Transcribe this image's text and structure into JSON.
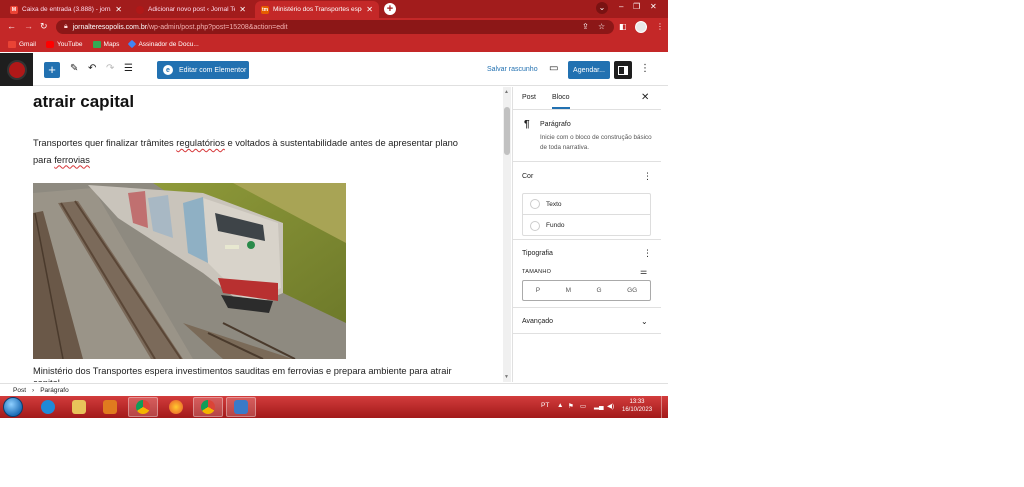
{
  "browser": {
    "tabs": [
      {
        "title": "Caixa de entrada (3.888) - jornalte",
        "favicon_color": "#ea4335",
        "favicon_name": "gmail-icon"
      },
      {
        "title": "Adicionar novo post ‹ Jornal Tere",
        "favicon_color": "#b01818",
        "favicon_name": "jornal-logo-icon"
      },
      {
        "title": "Ministério dos Transportes espe",
        "favicon_color": "#e65c00",
        "favicon_name": "jornal-logo-icon",
        "favicon_text": "tm"
      }
    ],
    "url_host": "jornalteresopolis.com.br",
    "url_path": "/wp-admin/post.php?post=15208&action=edit",
    "bookmarks": [
      {
        "label": "Gmail",
        "color": "#ea4335"
      },
      {
        "label": "YouTube",
        "color": "#ff0000"
      },
      {
        "label": "Maps",
        "color": "#34a853"
      },
      {
        "label": "Assinador de Docu...",
        "color": "#4285f4"
      }
    ]
  },
  "toolbar": {
    "add_label": "+",
    "elementor_label": "Editar com Elementor",
    "save_draft_label": "Salvar rascunho",
    "schedule_label": "Agendar..."
  },
  "post": {
    "heading": "atrair capital",
    "paragraph_pre": "Transportes quer finalizar trâmites ",
    "paragraph_word1": "regulatórios",
    "paragraph_mid": " e voltados à sustentabilidade antes de apresentar plano para ",
    "paragraph_word2": "ferrovias",
    "caption": "Ministério dos Transportes espera investimentos sauditas em ferrovias e prepara ambiente para atrair capital"
  },
  "sidebar": {
    "tab_post": "Post",
    "tab_block": "Bloco",
    "block_name": "Parágrafo",
    "block_desc": "Inicie com o bloco de construção básico de toda narrativa.",
    "color_title": "Cor",
    "color_text": "Texto",
    "color_background": "Fundo",
    "typography_title": "Tipografia",
    "size_label": "TAMANHO",
    "sizes": [
      "P",
      "M",
      "G",
      "GG"
    ],
    "advanced_title": "Avançado"
  },
  "breadcrumb": {
    "root": "Post",
    "separator": "›",
    "current": "Parágrafo"
  },
  "taskbar": {
    "language": "PT",
    "time": "13:33",
    "date": "16/10/2023"
  }
}
